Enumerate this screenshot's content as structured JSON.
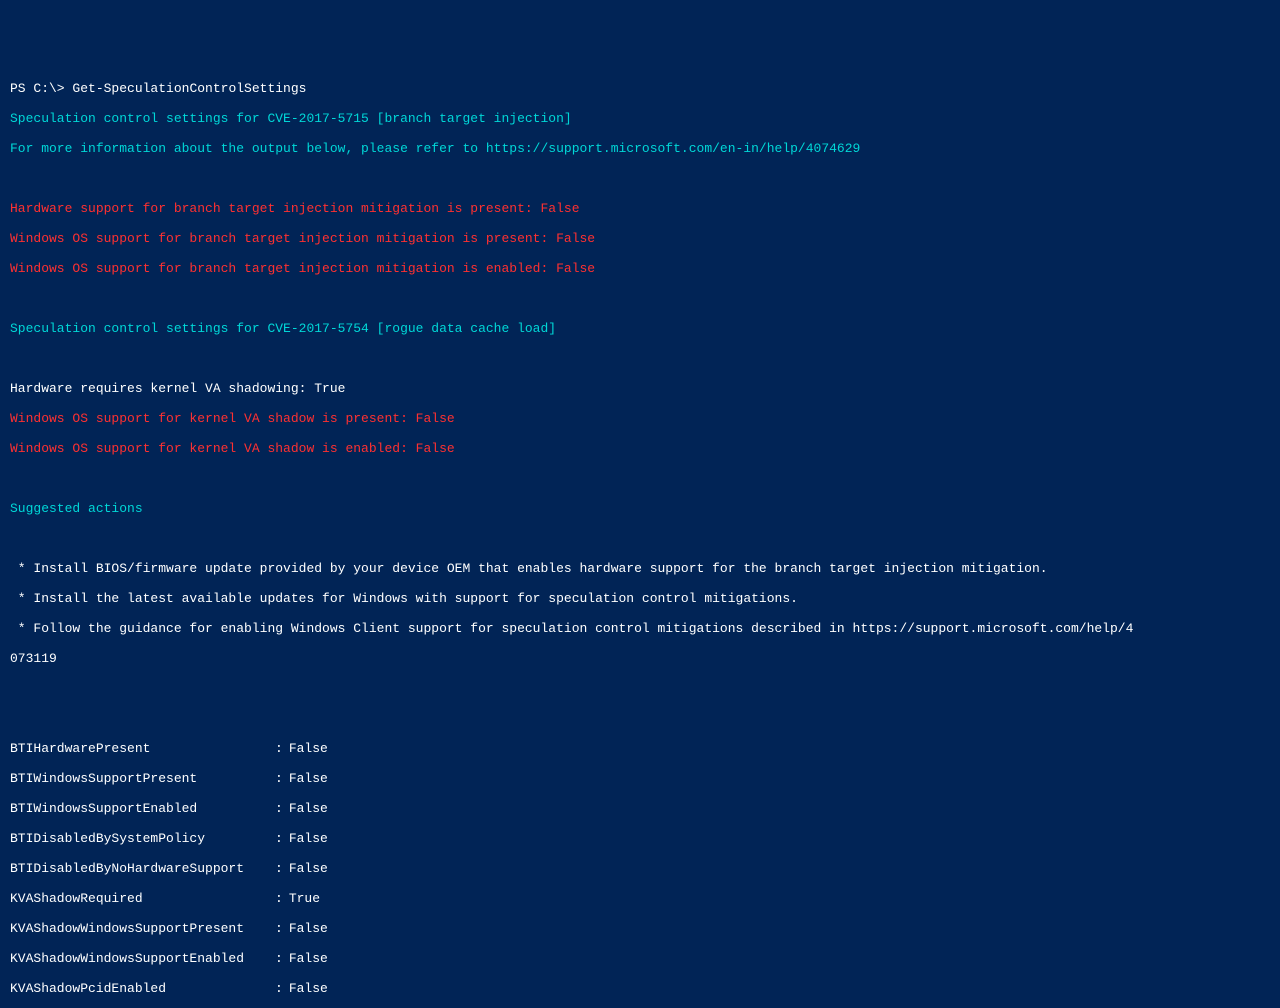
{
  "prompt": {
    "prefix": "PS C:\\> ",
    "command": "Get-SpeculationControlSettings"
  },
  "header1": "Speculation control settings for CVE-2017-5715 [branch target injection]",
  "info1": "For more information about the output below, please refer to https://support.microsoft.com/en-in/help/4074629",
  "bti": {
    "hw": "Hardware support for branch target injection mitigation is present: False",
    "os_present": "Windows OS support for branch target injection mitigation is present: False",
    "os_enabled": "Windows OS support for branch target injection mitigation is enabled: False"
  },
  "header2": "Speculation control settings for CVE-2017-5754 [rogue data cache load]",
  "kva": {
    "hw": "Hardware requires kernel VA shadowing: True",
    "os_present": "Windows OS support for kernel VA shadow is present: False",
    "os_enabled": "Windows OS support for kernel VA shadow is enabled: False"
  },
  "suggested_header": "Suggested actions",
  "suggestions": {
    "s1": " * Install BIOS/firmware update provided by your device OEM that enables hardware support for the branch target injection mitigation.",
    "s2": " * Install the latest available updates for Windows with support for speculation control mitigations.",
    "s3a": " * Follow the guidance for enabling Windows Client support for speculation control mitigations described in https://support.microsoft.com/help/4",
    "s3b": "073119"
  },
  "kv": [
    {
      "key": "BTIHardwarePresent",
      "value": "False"
    },
    {
      "key": "BTIWindowsSupportPresent",
      "value": "False"
    },
    {
      "key": "BTIWindowsSupportEnabled",
      "value": "False"
    },
    {
      "key": "BTIDisabledBySystemPolicy",
      "value": "False"
    },
    {
      "key": "BTIDisabledByNoHardwareSupport",
      "value": "False"
    },
    {
      "key": "KVAShadowRequired",
      "value": "True"
    },
    {
      "key": "KVAShadowWindowsSupportPresent",
      "value": "False"
    },
    {
      "key": "KVAShadowWindowsSupportEnabled",
      "value": "False"
    },
    {
      "key": "KVAShadowPcidEnabled",
      "value": "False"
    }
  ],
  "sep": ":"
}
